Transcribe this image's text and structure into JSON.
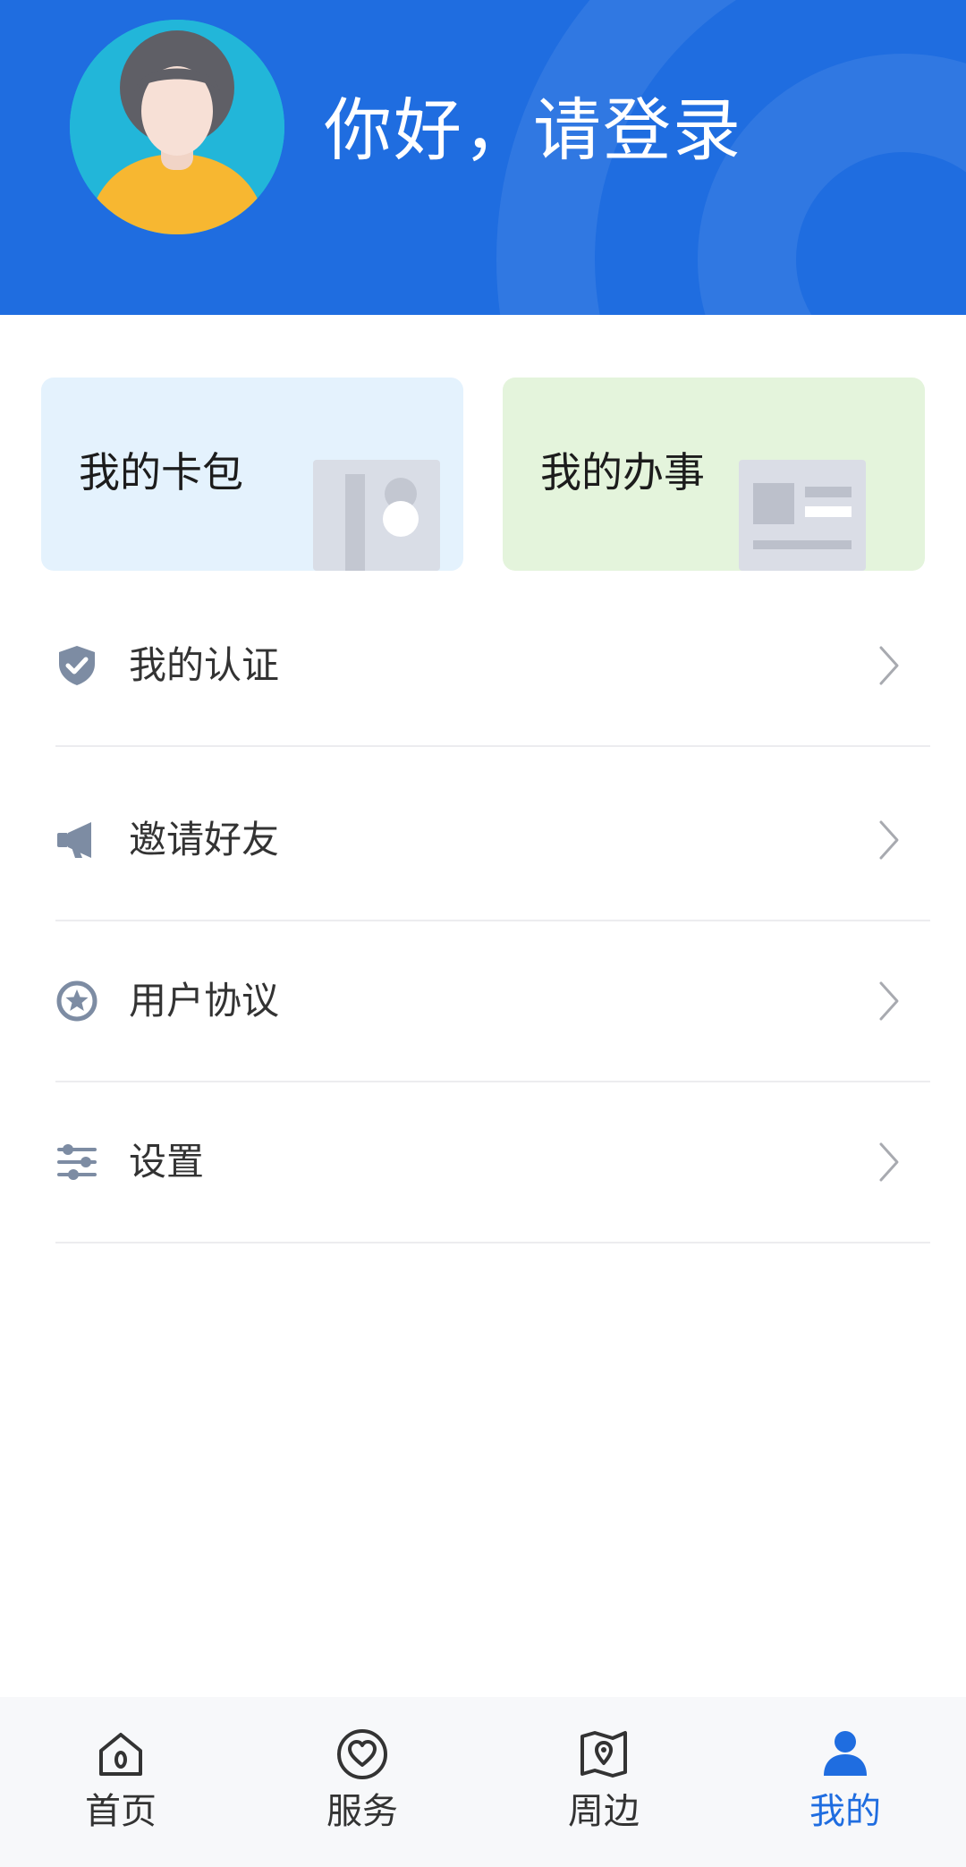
{
  "header": {
    "greeting": "你好，请登录",
    "background_color": "#1f6de0"
  },
  "cards": [
    {
      "label": "我的卡包",
      "background": "#e4f2fd"
    },
    {
      "label": "我的办事",
      "background": "#e4f4dc"
    }
  ],
  "menu": [
    {
      "label": "我的认证",
      "icon": "shield-check-icon"
    },
    {
      "label": "邀请好友",
      "icon": "megaphone-icon"
    },
    {
      "label": "用户协议",
      "icon": "star-circle-icon"
    },
    {
      "label": "设置",
      "icon": "sliders-icon"
    }
  ],
  "nav": {
    "active_index": 3,
    "active_color": "#1f6de0",
    "items": [
      {
        "label": "首页",
        "icon": "home-icon"
      },
      {
        "label": "服务",
        "icon": "heart-circle-icon"
      },
      {
        "label": "周边",
        "icon": "map-pin-icon"
      },
      {
        "label": "我的",
        "icon": "user-icon"
      }
    ]
  }
}
